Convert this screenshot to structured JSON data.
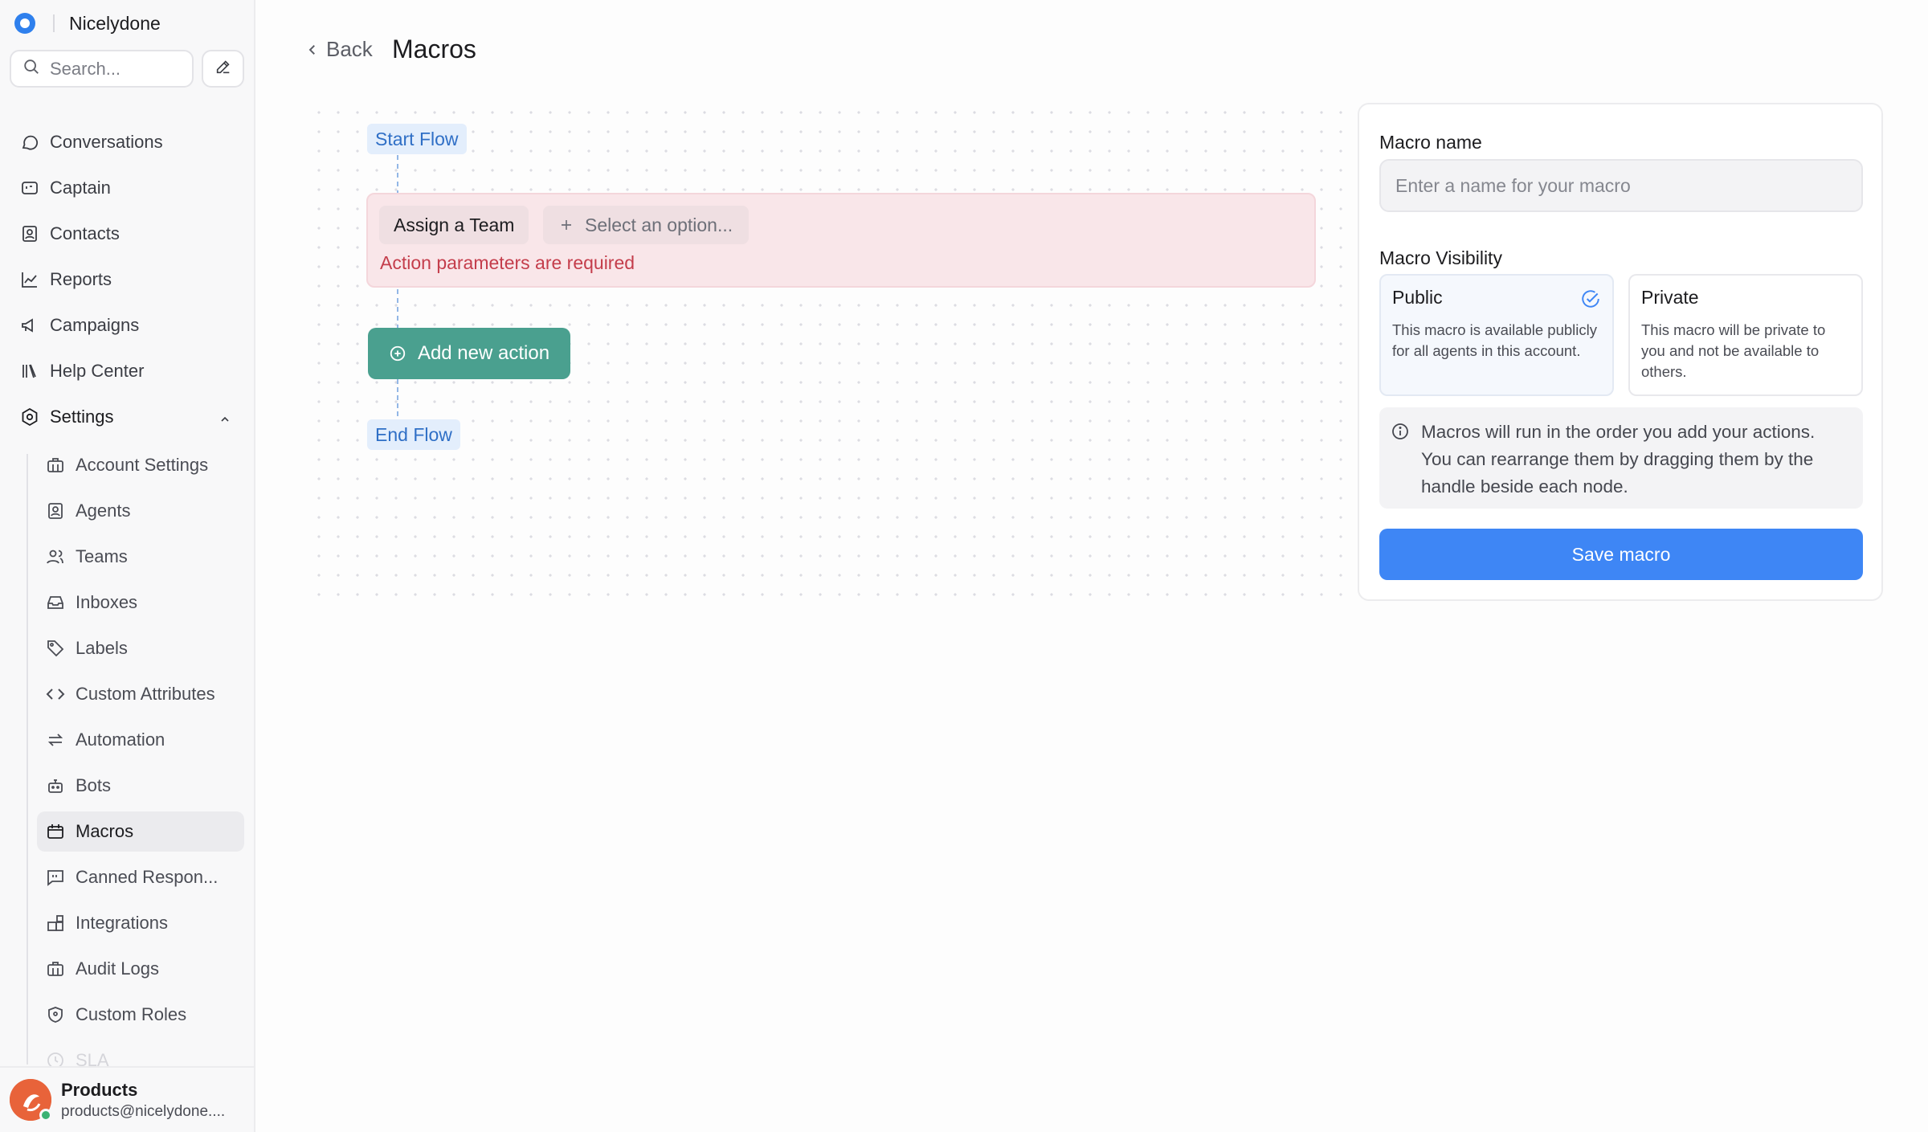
{
  "app": {
    "workspace_name": "Nicelydone"
  },
  "search": {
    "placeholder": "Search..."
  },
  "nav": {
    "items": [
      {
        "label": "Conversations",
        "icon": "chat-bubble-icon"
      },
      {
        "label": "Captain",
        "icon": "captain-icon"
      },
      {
        "label": "Contacts",
        "icon": "contact-card-icon"
      },
      {
        "label": "Reports",
        "icon": "line-chart-icon"
      },
      {
        "label": "Campaigns",
        "icon": "megaphone-icon"
      },
      {
        "label": "Help Center",
        "icon": "library-icon"
      }
    ],
    "settings_label": "Settings",
    "settings_items": [
      {
        "label": "Account Settings",
        "icon": "briefcase-icon"
      },
      {
        "label": "Agents",
        "icon": "agent-badge-icon"
      },
      {
        "label": "Teams",
        "icon": "users-icon"
      },
      {
        "label": "Inboxes",
        "icon": "inbox-icon"
      },
      {
        "label": "Labels",
        "icon": "tag-icon"
      },
      {
        "label": "Custom Attributes",
        "icon": "code-icon"
      },
      {
        "label": "Automation",
        "icon": "arrows-swap-icon"
      },
      {
        "label": "Bots",
        "icon": "bot-icon"
      },
      {
        "label": "Macros",
        "icon": "macro-icon"
      },
      {
        "label": "Canned Respon...",
        "icon": "quote-message-icon"
      },
      {
        "label": "Integrations",
        "icon": "blocks-icon"
      },
      {
        "label": "Audit Logs",
        "icon": "briefcase-icon"
      },
      {
        "label": "Custom Roles",
        "icon": "shield-icon"
      },
      {
        "label": "SLA",
        "icon": "clock-icon"
      }
    ],
    "active_item": "Macros"
  },
  "profile": {
    "name": "Products",
    "email": "products@nicelydone...."
  },
  "header": {
    "back_label": "Back",
    "title": "Macros"
  },
  "flow": {
    "start_label": "Start Flow",
    "end_label": "End Flow",
    "action": {
      "type_label": "Assign a Team",
      "select_placeholder": "Select an option...",
      "error": "Action parameters are required"
    },
    "add_action_label": "Add new action"
  },
  "panel": {
    "name_label": "Macro name",
    "name_placeholder": "Enter a name for your macro",
    "name_value": "",
    "visibility_label": "Macro Visibility",
    "visibility_options": [
      {
        "title": "Public",
        "description": "This macro is available publicly for all agents in this account.",
        "selected": true
      },
      {
        "title": "Private",
        "description": "This macro will be private to you and not be available to others.",
        "selected": false
      }
    ],
    "info_text": "Macros will run in the order you add your actions. You can rearrange them by dragging them by the handle beside each node.",
    "save_label": "Save macro"
  },
  "colors": {
    "accent_blue": "#3e86f5",
    "add_action_green": "#4aa08f",
    "error_red": "#c43d4b",
    "flow_tag_blue": "#2f6fc6"
  }
}
